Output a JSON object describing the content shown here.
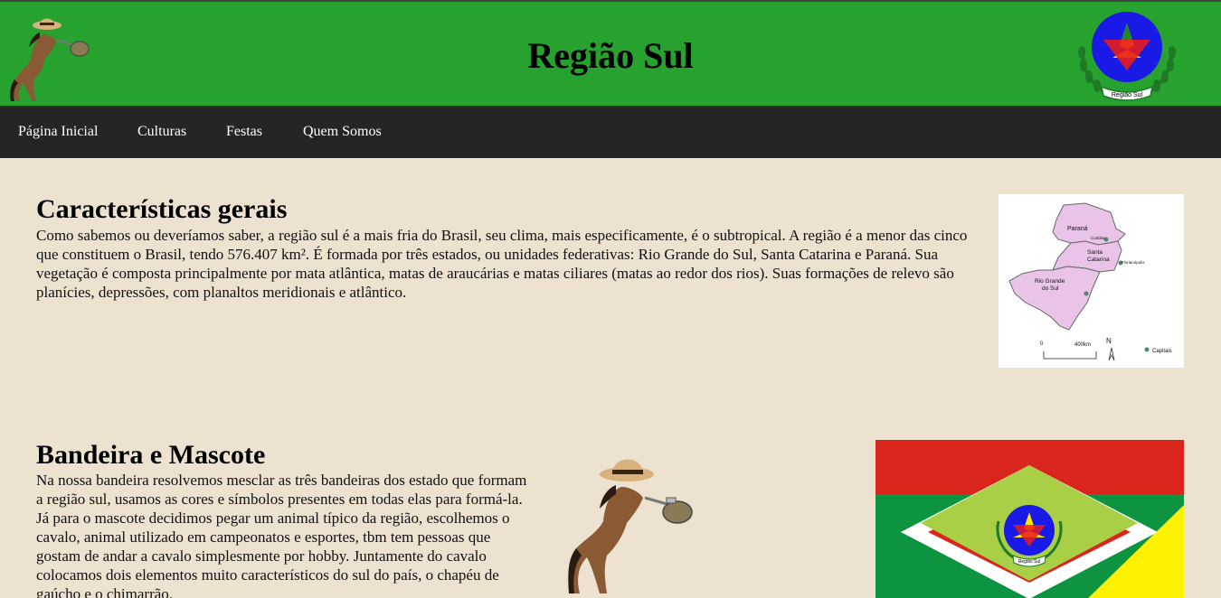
{
  "header": {
    "title": "Região Sul",
    "emblem_caption": "Região Sul"
  },
  "nav": {
    "items": [
      {
        "label": "Página Inicial"
      },
      {
        "label": "Culturas"
      },
      {
        "label": "Festas"
      },
      {
        "label": "Quem Somos"
      }
    ]
  },
  "sections": {
    "caracteristicas": {
      "title": "Características gerais",
      "text": "Como sabemos ou deveríamos saber, a região sul é a mais fria do Brasil, seu clima, mais especificamente, é o subtropical. A região é a menor das cinco que constituem o Brasil, tendo 576.407 km². É formada por três estados, ou unidades federativas: Rio Grande do Sul, Santa Catarina e Paraná. Sua vegetação é composta principalmente por mata atlântica, matas de araucárias e matas ciliares (matas ao redor dos rios). Suas formações de relevo são planícies, depressões, com planaltos meridionais e atlântico."
    },
    "bandeira": {
      "title": "Bandeira e Mascote",
      "text": "Na nossa bandeira resolvemos mesclar as três bandeiras dos estado que formam a região sul, usamos as cores e símbolos presentes em todas elas para formá-la. Já para o mascote decidimos pegar um animal típico da região, escolhemos o cavalo, animal utilizado em campeonatos e esportes, tbm tem pessoas que gostam de andar a cavalo simplesmente por hobby. Juntamente do cavalo colocamos dois elementos muito característicos do sul do país, o chapéu de gaúcho e o chimarrão."
    }
  },
  "map": {
    "labels": {
      "parana": "Paraná",
      "curitiba": "Curitiba",
      "santa_catarina_1": "Santa",
      "santa_catarina_2": "Catarina",
      "florianopolis": "Florianópolis",
      "rgs_1": "Rio Grande",
      "rgs_2": "do Sul",
      "scale_zero": "0",
      "scale_km": "400km",
      "north": "N",
      "legend": "Capitais"
    }
  },
  "flag": {
    "caption": "Região Sul"
  },
  "colors": {
    "header_green": "#27a22e",
    "nav_dark": "#252525",
    "page_beige": "#ede1cf",
    "map_pink": "#e9c4e8",
    "flag_red": "#d9251c",
    "flag_green": "#0c9440",
    "flag_yellow": "#fff200",
    "flag_lime": "#a8cf45",
    "emblem_blue": "#1a1ae6"
  },
  "icons": [
    "horse-mascot-icon",
    "region-emblem-icon",
    "south-map-image",
    "region-flag-image"
  ]
}
